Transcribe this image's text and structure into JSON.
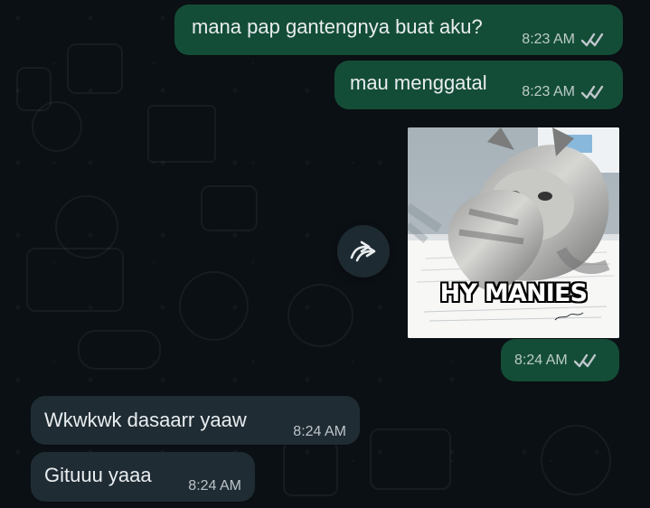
{
  "chat": {
    "messages": [
      {
        "text": "mana pap gantengnya buat aku?",
        "time": "8:23 AM",
        "direction": "outgoing",
        "read": true
      },
      {
        "text": "mau menggatal",
        "time": "8:23 AM",
        "direction": "outgoing",
        "read": true
      },
      {
        "type": "image",
        "image_caption": "HY MANIES",
        "time": "8:24 AM",
        "direction": "outgoing",
        "read": true
      },
      {
        "text": "Wkwkwk dasaarr yaaw",
        "time": "8:24 AM",
        "direction": "incoming"
      },
      {
        "text": "Gituuu yaaa",
        "time": "8:24 AM",
        "direction": "incoming"
      }
    ]
  },
  "icons": {
    "read": "double-check-icon",
    "forward": "forward-arrow-icon"
  },
  "colors": {
    "background": "#0b1014",
    "outgoing_bubble": "#144d37",
    "incoming_bubble": "#1f2c34",
    "read_ticks": "#bfc7cc"
  }
}
